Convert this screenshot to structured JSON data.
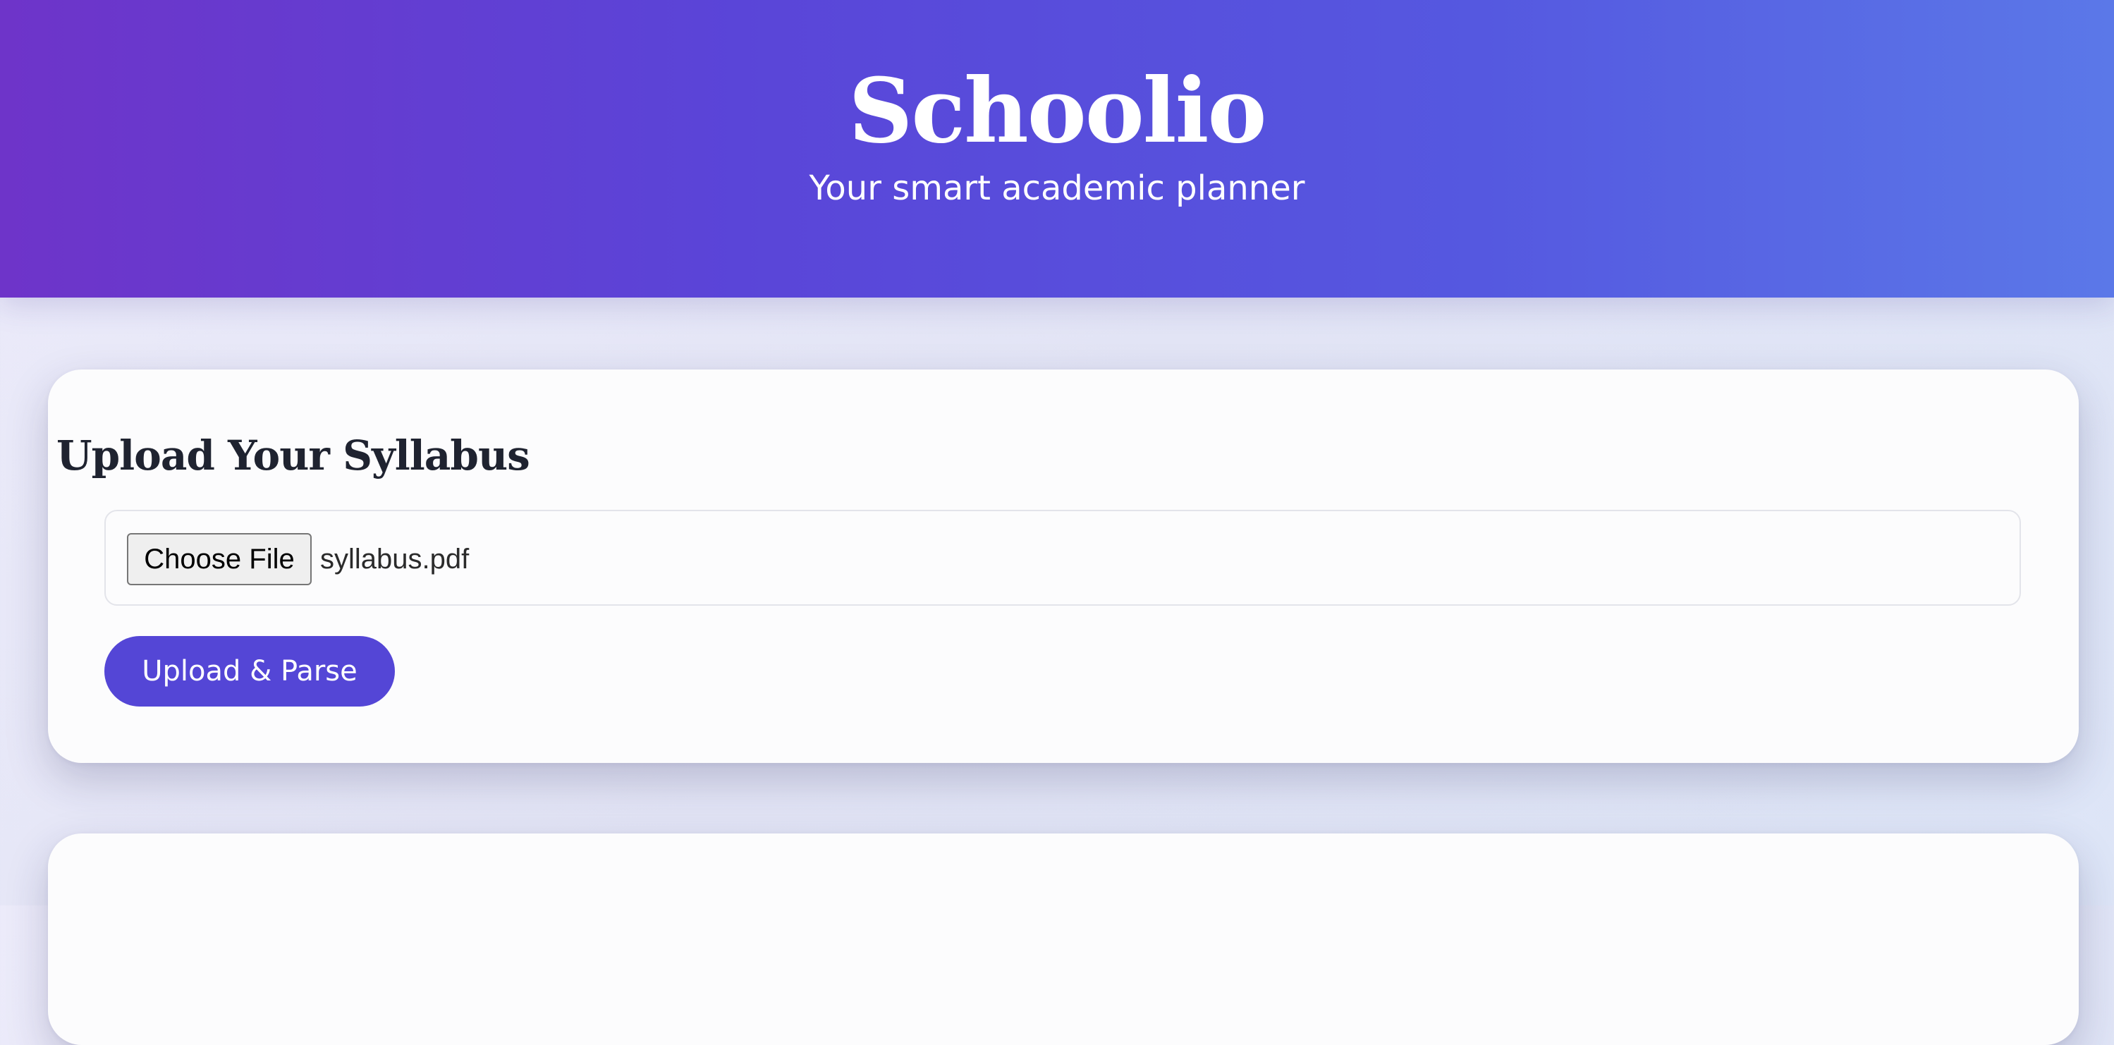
{
  "header": {
    "title": "Schoolio",
    "subtitle": "Your smart academic planner"
  },
  "upload_card": {
    "heading": "Upload Your Syllabus",
    "file_input": {
      "button_label": "Choose File",
      "selected_file": "syllabus.pdf"
    },
    "submit_label": "Upload & Parse"
  },
  "colors": {
    "header_gradient_start": "#6e34c9",
    "header_gradient_end": "#5b78e8",
    "accent": "#5446d6",
    "heading_text": "#1f2330",
    "page_background": "#e6e7f7"
  }
}
